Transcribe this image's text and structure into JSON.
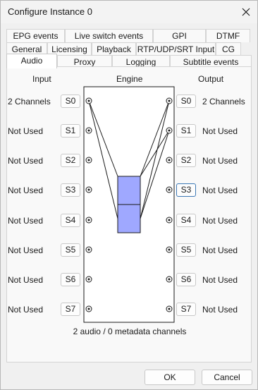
{
  "window": {
    "title": "Configure Instance 0"
  },
  "tabs": {
    "row1": [
      "EPG events",
      "Live switch events",
      "GPI",
      "DTMF"
    ],
    "row2": [
      "General",
      "Licensing",
      "Playback",
      "RTP/UDP/SRT Input",
      "CG"
    ],
    "row3": [
      "Audio",
      "Proxy",
      "Logging",
      "Subtitle events"
    ],
    "active": "Audio"
  },
  "audio": {
    "headers": {
      "input": "Input",
      "engine": "Engine",
      "output": "Output"
    },
    "slot_labels": [
      "S0",
      "S1",
      "S2",
      "S3",
      "S4",
      "S5",
      "S6",
      "S7"
    ],
    "inputs": [
      "2 Channels",
      "Not Used",
      "Not Used",
      "Not Used",
      "Not Used",
      "Not Used",
      "Not Used",
      "Not Used"
    ],
    "outputs": [
      "2 Channels",
      "Not Used",
      "Not Used",
      "Not Used",
      "Not Used",
      "Not Used",
      "Not Used",
      "Not Used"
    ],
    "focused_output": "S3",
    "engine_box_color": "#9fa8ff",
    "summary": "2 audio / 0 metadata channels"
  },
  "buttons": {
    "ok": "OK",
    "cancel": "Cancel"
  }
}
